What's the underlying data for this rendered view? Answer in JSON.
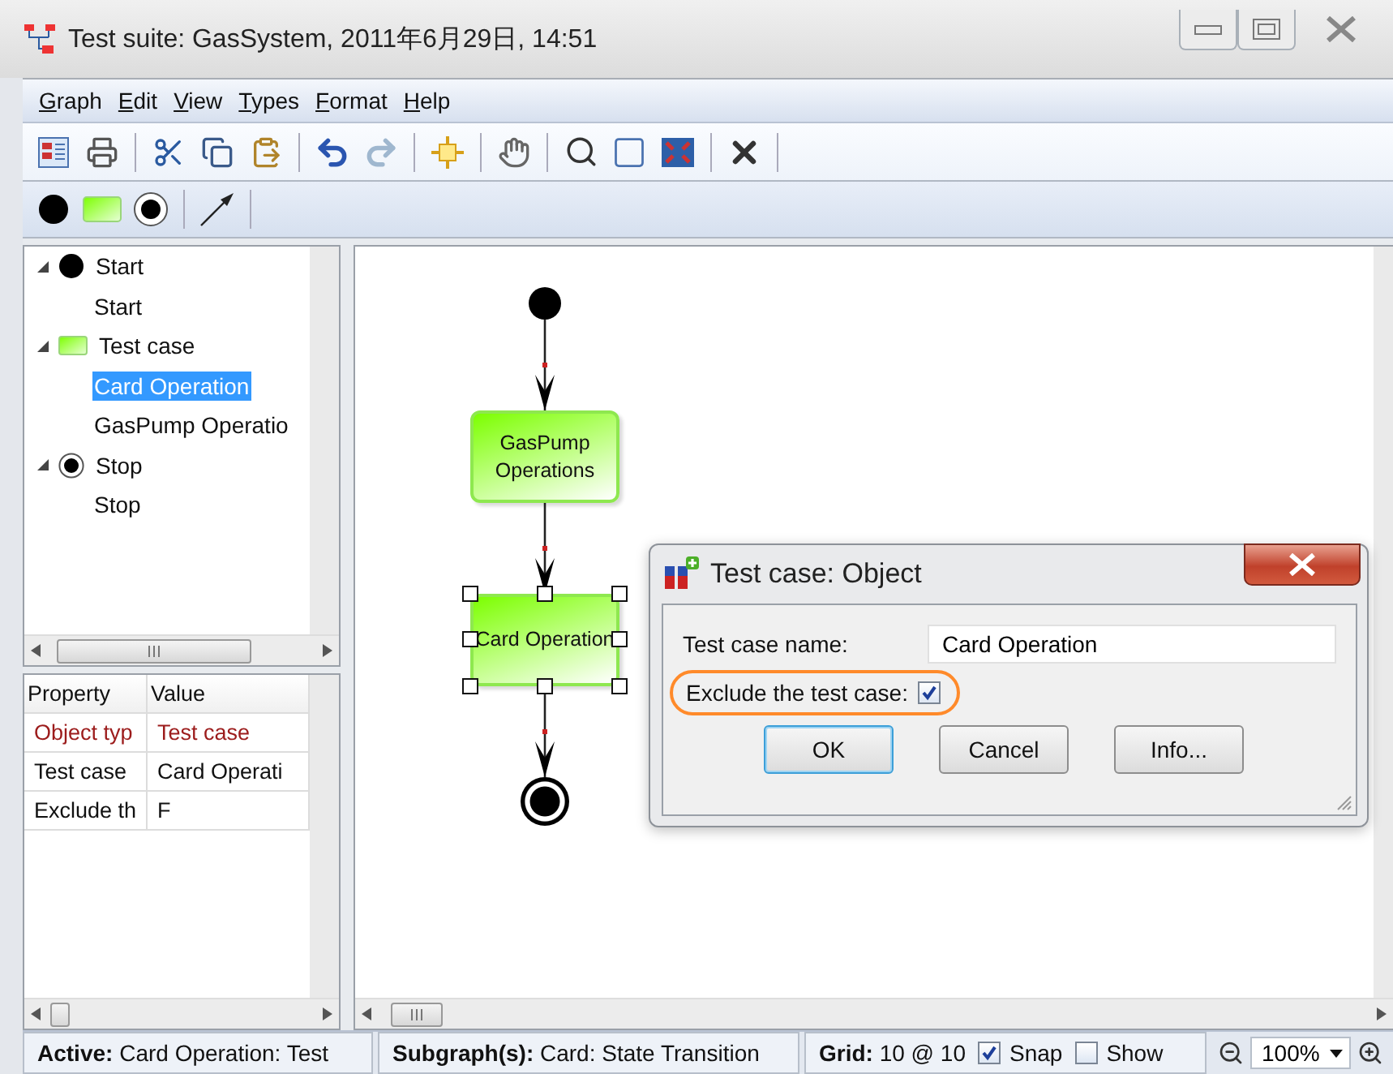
{
  "window": {
    "title": "Test suite: GasSystem, 2011年6月29日, 14:51"
  },
  "menu": [
    "Graph",
    "Edit",
    "View",
    "Types",
    "Format",
    "Help"
  ],
  "tree": [
    {
      "label": "Start",
      "kind": "start",
      "expanded": true,
      "children": [
        {
          "label": "Start",
          "selected": false
        }
      ]
    },
    {
      "label": "Test case",
      "kind": "testcase",
      "expanded": true,
      "children": [
        {
          "label": "Card Operation",
          "selected": true
        },
        {
          "label": "GasPump Operatio",
          "selected": false
        }
      ]
    },
    {
      "label": "Stop",
      "kind": "stop",
      "expanded": true,
      "children": [
        {
          "label": "Stop",
          "selected": false
        }
      ]
    }
  ],
  "properties": {
    "columns": [
      "Property",
      "Value"
    ],
    "rows": [
      {
        "cells": [
          "Object typ",
          "Test case"
        ],
        "emphasized": true
      },
      {
        "cells": [
          "Test case",
          "Card Operati"
        ],
        "emphasized": false
      },
      {
        "cells": [
          "Exclude th",
          "F"
        ],
        "emphasized": false
      }
    ]
  },
  "diagram": {
    "nodes": [
      {
        "kind": "start",
        "selected": false
      },
      {
        "kind": "testcase",
        "label": "GasPump Operations",
        "selected": false
      },
      {
        "kind": "testcase",
        "label": "Card Operation",
        "selected": true
      },
      {
        "kind": "stop",
        "selected": false
      }
    ]
  },
  "dialog": {
    "title": "Test case: Object",
    "name_label": "Test case name:",
    "name_value": "Card Operation",
    "exclude_label": "Exclude the test case:",
    "exclude_checked": true,
    "buttons": [
      {
        "label": "OK",
        "default": true
      },
      {
        "label": "Cancel",
        "default": false
      },
      {
        "label": "Info...",
        "default": false
      }
    ]
  },
  "status_bar": {
    "active_label": "Active:",
    "active_value": "Card Operation: Test",
    "subgraph_label": "Subgraph(s):",
    "subgraph_value": "Card: State Transition",
    "grid_label": "Grid:",
    "grid_value": "10 @ 10",
    "options": [
      {
        "label": "Snap",
        "checked": true
      },
      {
        "label": "Show",
        "checked": false
      }
    ],
    "zoom": "100%"
  }
}
